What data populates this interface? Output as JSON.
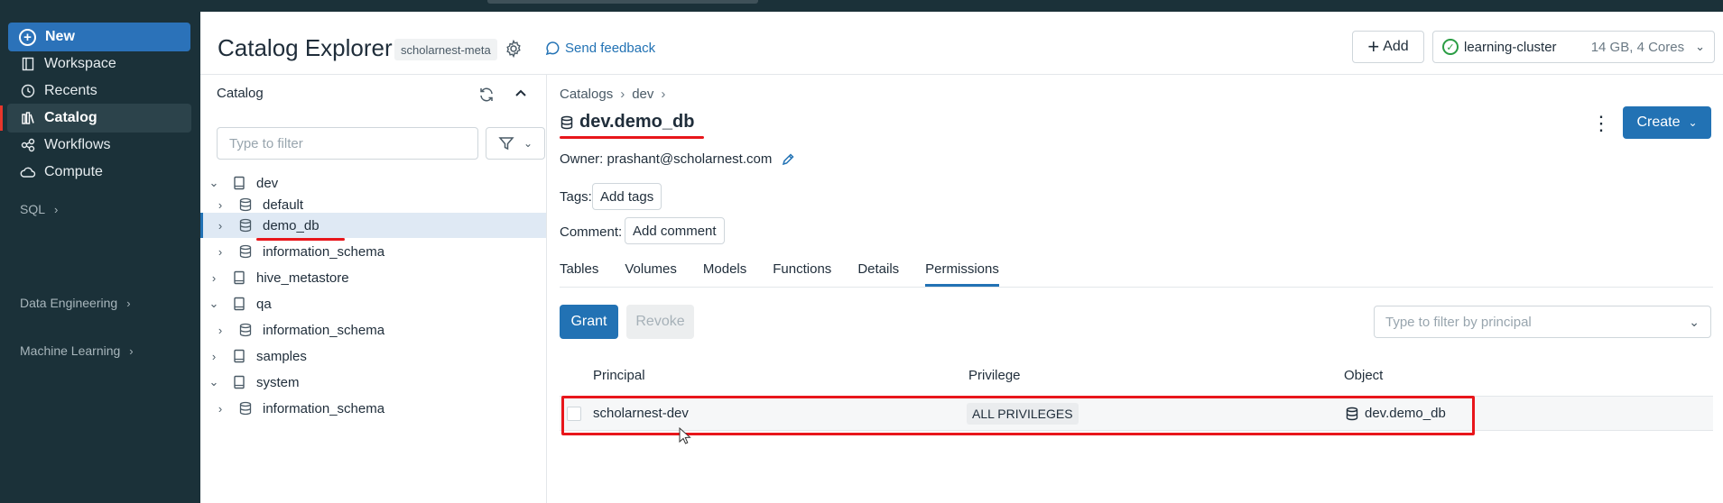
{
  "sidebar": {
    "new_label": "New",
    "items": [
      {
        "label": "Workspace",
        "icon": "workspace-icon"
      },
      {
        "label": "Recents",
        "icon": "clock-icon"
      },
      {
        "label": "Catalog",
        "icon": "catalog-icon",
        "active": true
      },
      {
        "label": "Workflows",
        "icon": "workflows-icon"
      },
      {
        "label": "Compute",
        "icon": "cloud-icon"
      }
    ],
    "groups": [
      {
        "label": "SQL"
      },
      {
        "label": "Data Engineering"
      },
      {
        "label": "Machine Learning"
      }
    ]
  },
  "header": {
    "title": "Catalog Explorer",
    "metastore": "scholarnest-meta",
    "feedback": "Send feedback",
    "add_label": "Add",
    "cluster_name": "learning-cluster",
    "cluster_spec": "14 GB, 4 Cores"
  },
  "catalog_panel": {
    "title": "Catalog",
    "filter_placeholder": "Type to filter",
    "tree": [
      {
        "label": "dev",
        "level": 0,
        "expanded": true,
        "type": "catalog"
      },
      {
        "label": "default",
        "level": 1,
        "expanded": false,
        "type": "schema"
      },
      {
        "label": "demo_db",
        "level": 1,
        "expanded": false,
        "type": "schema",
        "selected": true
      },
      {
        "label": "information_schema",
        "level": 1,
        "expanded": false,
        "type": "schema"
      },
      {
        "label": "hive_metastore",
        "level": 0,
        "expanded": false,
        "type": "catalog"
      },
      {
        "label": "qa",
        "level": 0,
        "expanded": true,
        "type": "catalog"
      },
      {
        "label": "information_schema",
        "level": 1,
        "expanded": false,
        "type": "schema"
      },
      {
        "label": "samples",
        "level": 0,
        "expanded": false,
        "type": "catalog"
      },
      {
        "label": "system",
        "level": 0,
        "expanded": true,
        "type": "catalog"
      },
      {
        "label": "information_schema",
        "level": 1,
        "expanded": false,
        "type": "schema"
      }
    ]
  },
  "detail": {
    "breadcrumb": [
      "Catalogs",
      "dev"
    ],
    "title": "dev.demo_db",
    "owner": "Owner: prashant@scholarnest.com",
    "tags_label": "Tags:",
    "add_tags": "Add tags",
    "comment_label": "Comment:",
    "add_comment": "Add comment",
    "create_label": "Create",
    "tabs": [
      {
        "label": "Tables"
      },
      {
        "label": "Volumes"
      },
      {
        "label": "Models"
      },
      {
        "label": "Functions"
      },
      {
        "label": "Details"
      },
      {
        "label": "Permissions",
        "active": true
      }
    ],
    "grant_label": "Grant",
    "revoke_label": "Revoke",
    "principal_filter_placeholder": "Type to filter by principal",
    "columns": [
      "Principal",
      "Privilege",
      "Object"
    ],
    "rows": [
      {
        "principal": "scholarnest-dev",
        "privilege": "ALL PRIVILEGES",
        "object": "dev.demo_db"
      }
    ]
  },
  "colors": {
    "sidebar_bg": "#1b3139",
    "primary": "#2272b4",
    "annotation_red": "#e8161b"
  }
}
